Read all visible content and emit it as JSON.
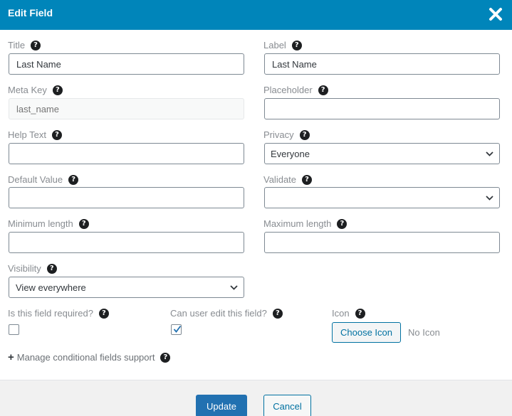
{
  "header": {
    "title": "Edit Field"
  },
  "fields": {
    "title": {
      "label": "Title",
      "value": "Last Name"
    },
    "label": {
      "label": "Label",
      "value": "Last Name"
    },
    "meta_key": {
      "label": "Meta Key",
      "placeholder": "last_name"
    },
    "placeholder": {
      "label": "Placeholder",
      "value": ""
    },
    "help_text": {
      "label": "Help Text",
      "value": ""
    },
    "privacy": {
      "label": "Privacy",
      "selected": "Everyone"
    },
    "default_value": {
      "label": "Default Value",
      "value": ""
    },
    "validate": {
      "label": "Validate",
      "selected": ""
    },
    "min_length": {
      "label": "Minimum length",
      "value": ""
    },
    "max_length": {
      "label": "Maximum length",
      "value": ""
    },
    "visibility": {
      "label": "Visibility",
      "selected": "View everywhere"
    },
    "required": {
      "label": "Is this field required?",
      "checked": false
    },
    "user_edit": {
      "label": "Can user edit this field?",
      "checked": true
    },
    "icon": {
      "label": "Icon",
      "button": "Choose Icon",
      "status": "No Icon"
    }
  },
  "help_glyph": "?",
  "manage_conditional": {
    "icon": "+",
    "label": "Manage conditional fields support"
  },
  "footer": {
    "update_label": "Update",
    "cancel_label": "Cancel"
  }
}
